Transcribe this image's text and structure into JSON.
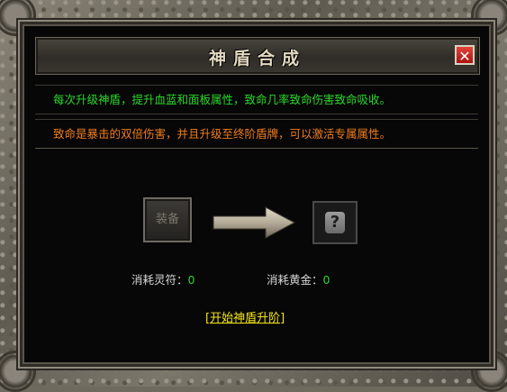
{
  "dialog": {
    "title": "神盾合成",
    "close_label": "✕"
  },
  "info": {
    "line1": "每次升级神盾，提升血蓝和面板属性，致命几率致命伤害致命吸收。",
    "line2": "致命是暴击的双倍伤害，并且升级至终阶盾牌，可以激活专属属性。"
  },
  "slots": {
    "equip_label": "装备",
    "result_label": "?"
  },
  "costs": {
    "talisman_label": "消耗灵符：",
    "talisman_value": "0",
    "gold_label": "消耗黄金：",
    "gold_value": "0"
  },
  "actions": {
    "start_label": "[开始神盾升阶]"
  },
  "colors": {
    "info_green": "#2cd82c",
    "info_orange": "#f07c1c",
    "link_yellow": "#f2e414",
    "close_red": "#c8261f"
  }
}
